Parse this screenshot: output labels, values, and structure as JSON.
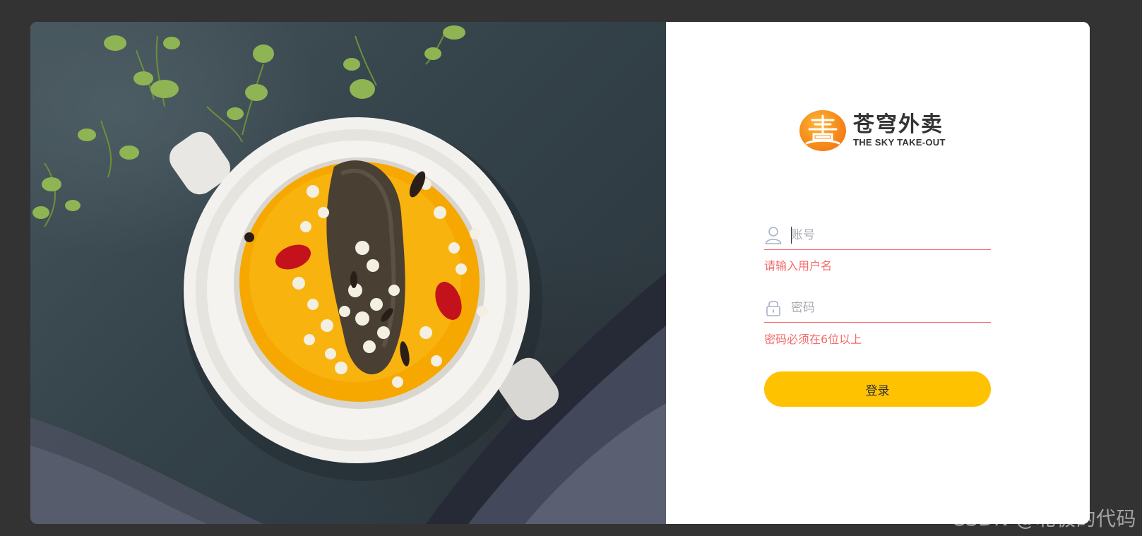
{
  "logo": {
    "name_cn": "苍穹外卖",
    "name_en": "THE SKY TAKE-OUT",
    "badge_glyph": "壽",
    "brand_color": "#f7921e"
  },
  "form": {
    "username": {
      "placeholder": "账号",
      "value": "",
      "icon": "user-icon",
      "error": "请输入用户名"
    },
    "password": {
      "placeholder": "密码",
      "value": "",
      "icon": "lock-icon",
      "error": "密码必须在6位以上"
    },
    "submit_label": "登录"
  },
  "colors": {
    "page_bg": "#333333",
    "error": "#f56c6c",
    "button": "#ffc200"
  },
  "watermark": "CSDN @北极的代码"
}
